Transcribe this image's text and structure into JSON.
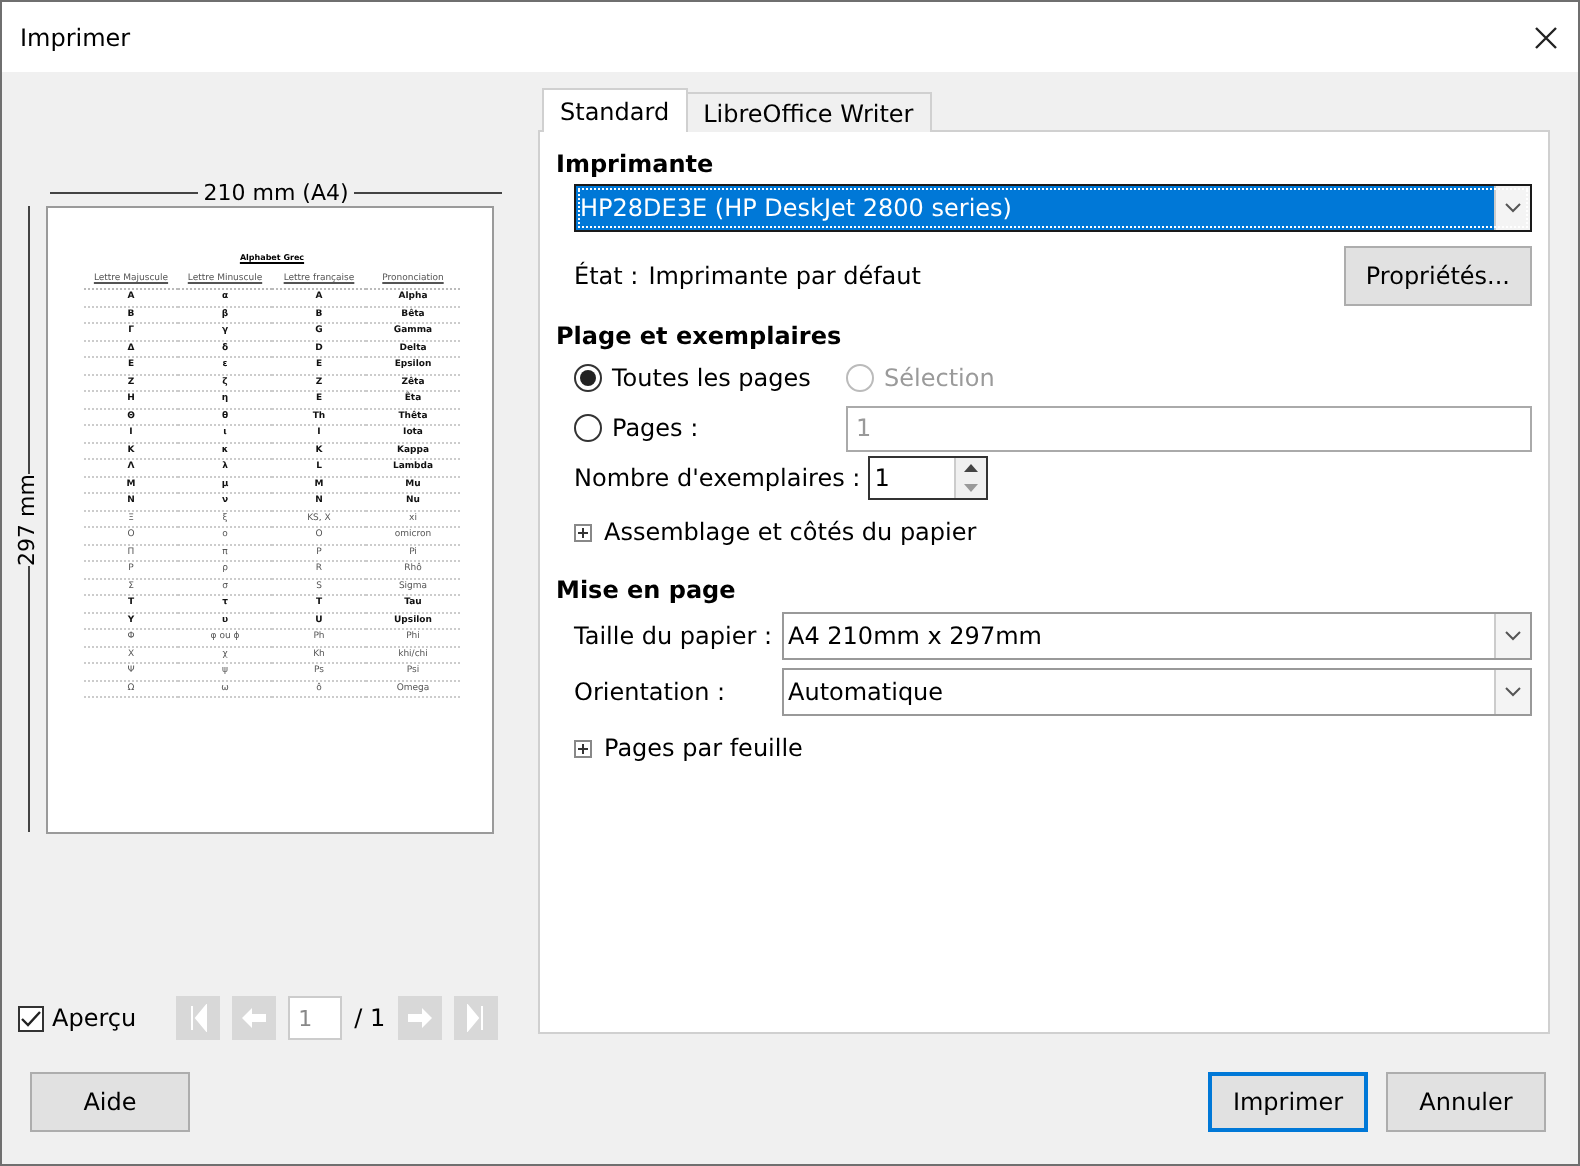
{
  "window": {
    "title": "Imprimer"
  },
  "preview": {
    "width_label": "210 mm (A4)",
    "height_label": "297 mm",
    "document": {
      "title": "Alphabet Grec",
      "columns": [
        "Lettre Majuscule",
        "Lettre Minuscule",
        "Lettre française",
        "Prononciation"
      ],
      "rows": [
        {
          "cells": [
            "Α",
            "α",
            "A",
            "Alpha"
          ],
          "bold": true
        },
        {
          "cells": [
            "Β",
            "β",
            "B",
            "Bêta"
          ],
          "bold": true
        },
        {
          "cells": [
            "Γ",
            "γ",
            "G",
            "Gamma"
          ],
          "bold": true
        },
        {
          "cells": [
            "Δ",
            "δ",
            "D",
            "Delta"
          ],
          "bold": true
        },
        {
          "cells": [
            "Ε",
            "ε",
            "E",
            "Epsilon"
          ],
          "bold": true
        },
        {
          "cells": [
            "Ζ",
            "ζ",
            "Z",
            "Zêta"
          ],
          "bold": true
        },
        {
          "cells": [
            "Η",
            "η",
            "E",
            "Êta"
          ],
          "bold": true
        },
        {
          "cells": [
            "Θ",
            "θ",
            "Th",
            "Thêta"
          ],
          "bold": true
        },
        {
          "cells": [
            "Ι",
            "ι",
            "I",
            "Iota"
          ],
          "bold": true
        },
        {
          "cells": [
            "Κ",
            "κ",
            "K",
            "Kappa"
          ],
          "bold": true
        },
        {
          "cells": [
            "Λ",
            "λ",
            "L",
            "Lambda"
          ],
          "bold": true
        },
        {
          "cells": [
            "Μ",
            "μ",
            "M",
            "Mu"
          ],
          "bold": true
        },
        {
          "cells": [
            "Ν",
            "ν",
            "N",
            "Nu"
          ],
          "bold": true
        },
        {
          "cells": [
            "Ξ",
            "ξ",
            "KS, X",
            "xi"
          ],
          "bold": false
        },
        {
          "cells": [
            "Ο",
            "ο",
            "O",
            "omicron"
          ],
          "bold": false
        },
        {
          "cells": [
            "Π",
            "π",
            "P",
            "Pi"
          ],
          "bold": false
        },
        {
          "cells": [
            "Ρ",
            "ρ",
            "R",
            "Rhô"
          ],
          "bold": false
        },
        {
          "cells": [
            "Σ",
            "σ",
            "S",
            "Sigma"
          ],
          "bold": false
        },
        {
          "cells": [
            "Τ",
            "τ",
            "T",
            "Tau"
          ],
          "bold": true
        },
        {
          "cells": [
            "Υ",
            "υ",
            "U",
            "Upsilon"
          ],
          "bold": true
        },
        {
          "cells": [
            "Φ",
            "φ ou ϕ",
            "Ph",
            "Phi"
          ],
          "bold": false
        },
        {
          "cells": [
            "Χ",
            "χ",
            "Kh",
            "khi/chi"
          ],
          "bold": false
        },
        {
          "cells": [
            "Ψ",
            "ψ",
            "Ps",
            "Psi"
          ],
          "bold": false
        },
        {
          "cells": [
            "Ω",
            "ω",
            "ô",
            "Omega"
          ],
          "bold": false
        }
      ]
    },
    "show_preview": {
      "label": "Aperçu",
      "checked": true
    },
    "page_field": "1",
    "page_total": "/ 1"
  },
  "tabs": [
    {
      "label": "Standard",
      "selected": true
    },
    {
      "label": "LibreOffice Writer",
      "selected": false
    }
  ],
  "printer": {
    "heading": "Imprimante",
    "device": "HP28DE3E (HP DeskJet 2800 series)",
    "status_label": "État :",
    "status": "Imprimante par défaut",
    "properties_button": "Propriétés..."
  },
  "range": {
    "heading": "Plage et exemplaires",
    "options": [
      {
        "label": "Toutes les pages",
        "selected": true,
        "disabled": false
      },
      {
        "label": "Sélection",
        "selected": false,
        "disabled": true
      },
      {
        "label": "Pages :",
        "selected": false,
        "disabled": false
      }
    ],
    "pages_field": "1",
    "copies_label": "Nombre d'exemplaires :",
    "copies": "1",
    "expander": {
      "label": "Assemblage et côtés du papier",
      "expanded": false
    }
  },
  "layout": {
    "heading": "Mise en page",
    "fields": [
      {
        "label": "Taille du papier :",
        "value": "A4 210mm x 297mm"
      },
      {
        "label": "Orientation :",
        "value": "Automatique"
      }
    ],
    "expander": {
      "label": "Pages par feuille",
      "expanded": false
    }
  },
  "buttons": {
    "help": "Aide",
    "actions": [
      {
        "label": "Imprimer",
        "default": true
      },
      {
        "label": "Annuler",
        "default": false
      }
    ]
  }
}
